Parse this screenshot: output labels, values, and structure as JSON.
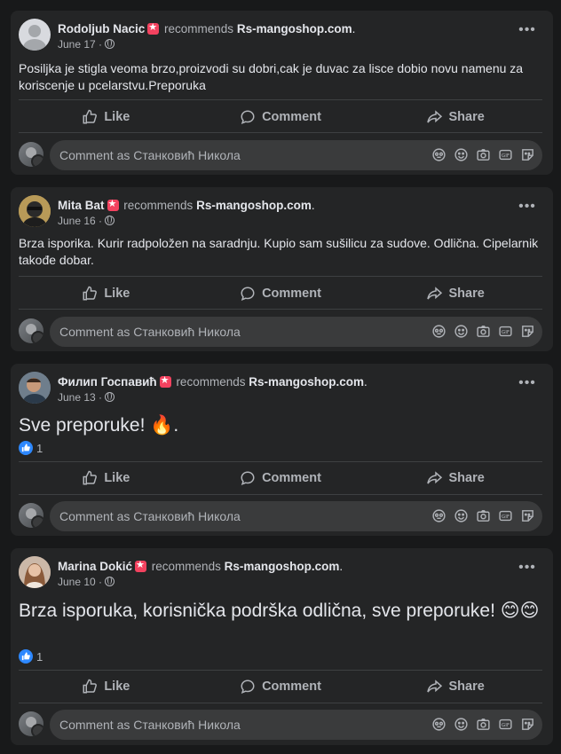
{
  "recommends_word": "recommends",
  "comment_placeholder": "Comment as Станковић Никола",
  "actions": {
    "like": "Like",
    "comment": "Comment",
    "share": "Share"
  },
  "posts": [
    {
      "author": "Rodoljub Nacic",
      "page": "Rs-mangoshop.com",
      "date": "June 17",
      "text": "Posiljka je stigla veoma brzo,proizvodi su dobri,cak je duvac za lisce dobio novu namenu za koriscenje u pcelarstvu.Preporuka",
      "likes": ""
    },
    {
      "author": "Mita Bat",
      "page": "Rs-mangoshop.com",
      "date": "June 16",
      "text": "Brza isporika. Kurir radpoložen na saradnju. Kupio sam sušilicu za sudove. Odlična. Cipelarnik takođe dobar.",
      "likes": ""
    },
    {
      "author": "Филип Госпавић",
      "page": "Rs-mangoshop.com",
      "date": "June 13",
      "text": "Sve preporuke! 🔥.",
      "likes": "1"
    },
    {
      "author": "Marina Dokić",
      "page": "Rs-mangoshop.com",
      "date": "June 10",
      "text": "Brza isporuka, korisnička podrška odlična, sve preporuke! 😊😊",
      "likes": "1"
    }
  ],
  "colors": {
    "background": "#18191a",
    "card": "#242526",
    "like_blue": "#2d88ff",
    "recommend_red": "#f3425f"
  },
  "icons": [
    "more-icon",
    "globe-icon",
    "like-icon",
    "comment-icon",
    "share-icon",
    "avatar-sticker-icon",
    "emoji-icon",
    "camera-icon",
    "gif-icon",
    "sticker-icon"
  ]
}
